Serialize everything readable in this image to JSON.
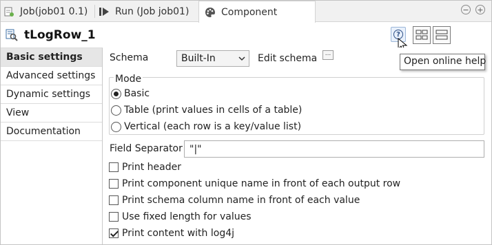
{
  "tabs": [
    {
      "label": "Job(job01 0.1)",
      "icon": "job-icon"
    },
    {
      "label": "Run (Job job01)",
      "icon": "run-icon"
    },
    {
      "label": "Component",
      "icon": "palette-icon",
      "active": true
    }
  ],
  "window_controls": {
    "minimize": "−",
    "maximize": "+"
  },
  "component": {
    "title": "tLogRow_1",
    "icon": "component-search-icon"
  },
  "help": {
    "icon": "question-icon",
    "tooltip": "Open online help"
  },
  "sidebar": {
    "items": [
      {
        "label": "Basic settings",
        "active": true
      },
      {
        "label": "Advanced settings"
      },
      {
        "label": "Dynamic settings"
      },
      {
        "label": "View"
      },
      {
        "label": "Documentation"
      }
    ]
  },
  "schema": {
    "label": "Schema",
    "value": "Built-In",
    "edit_label": "Edit schema",
    "edit_button": "..."
  },
  "mode": {
    "legend": "Mode",
    "options": [
      {
        "label": "Basic",
        "selected": true
      },
      {
        "label": "Table (print values in cells of a table)",
        "selected": false
      },
      {
        "label": "Vertical (each row is a key/value list)",
        "selected": false
      }
    ]
  },
  "field_separator": {
    "label": "Field Separator",
    "value": "\"|\""
  },
  "checkboxes": [
    {
      "label": "Print header",
      "checked": false
    },
    {
      "label": "Print component unique name in front of each output row",
      "checked": false
    },
    {
      "label": "Print schema column name in front of each value",
      "checked": false
    },
    {
      "label": "Use fixed length for values",
      "checked": false
    },
    {
      "label": "Print content with log4j",
      "checked": true
    }
  ],
  "colors": {
    "tab_bar": "#f1f1f1",
    "active_sidebar": "#e6e6e6",
    "help_button_bg": "#e8f0fb"
  }
}
